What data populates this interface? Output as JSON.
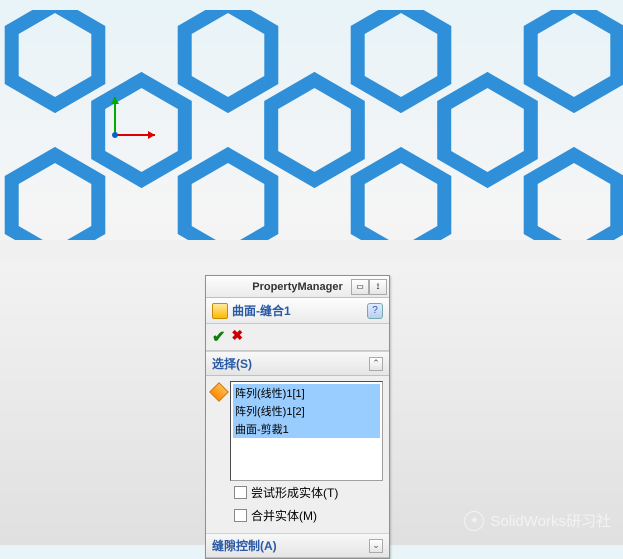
{
  "panel": {
    "title": "PropertyManager",
    "feature": {
      "name": "曲面-缝合1",
      "help": "?"
    },
    "confirm": {
      "ok": "✔",
      "cancel": "✖"
    },
    "sections": {
      "selection": {
        "label": "选择(S)",
        "items": [
          "阵列(线性)1[1]",
          "阵列(线性)1[2]",
          "曲面-剪裁1"
        ],
        "checkboxes": {
          "try_solid": "尝试形成实体(T)",
          "merge": "合并实体(M)"
        }
      },
      "gap": {
        "label": "缝隙控制(A)"
      }
    }
  },
  "watermark": {
    "text": "SolidWorks研习社"
  },
  "colors": {
    "hex_fill": "#2f8fd8",
    "hex_stroke": "#1a5fa0"
  }
}
